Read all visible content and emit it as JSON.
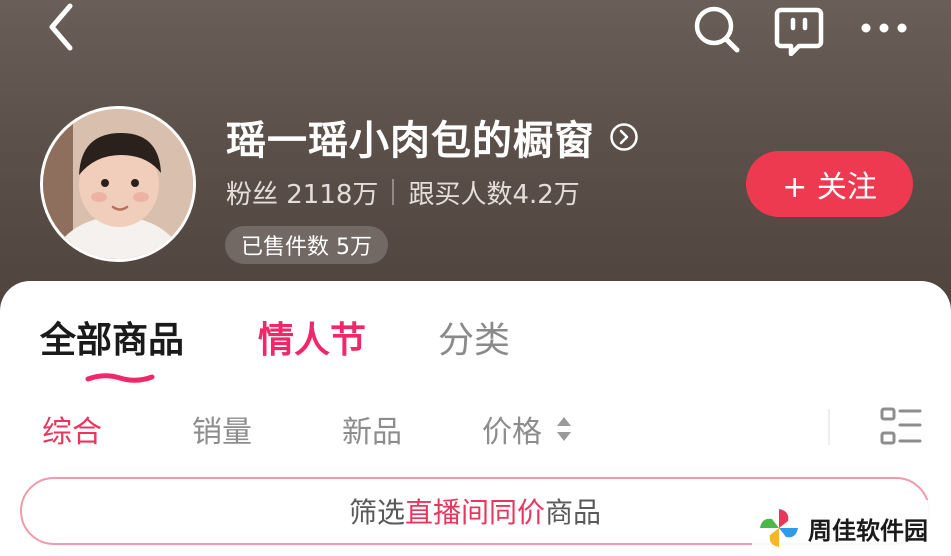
{
  "header": {
    "shop_title": "瑶一瑶小肉包的橱窗",
    "fans_label": "粉丝 2118万",
    "buyers_label": "跟买人数4.2万",
    "sold_label": "已售件数 5万",
    "follow_label": "+ 关注"
  },
  "tabs": [
    {
      "label": "全部商品",
      "active": true
    },
    {
      "label": "情人节",
      "active": false
    },
    {
      "label": "分类",
      "active": false
    }
  ],
  "sort": {
    "items": [
      {
        "label": "综合",
        "active": true
      },
      {
        "label": "销量",
        "active": false
      },
      {
        "label": "新品",
        "active": false
      },
      {
        "label": "价格",
        "active": false
      }
    ]
  },
  "filter_banner": {
    "prefix": "筛选 ",
    "highlight": "直播间同价",
    "suffix": " 商品"
  },
  "watermark": {
    "text": "周佳软件园"
  },
  "icons": {
    "back": "chevron-left-icon",
    "search": "search-icon",
    "message": "chat-bubble-icon",
    "more": "more-dots-icon",
    "title_arrow": "circle-chevron-right-icon",
    "price_sort": "sort-up-down-icon",
    "list_view": "list-view-icon",
    "watermark_logo": "pinwheel-logo-icon"
  },
  "colors": {
    "accent": "#ee3a50",
    "valentine_tab": "#f0286a",
    "header_bg": "#5b4f49"
  }
}
